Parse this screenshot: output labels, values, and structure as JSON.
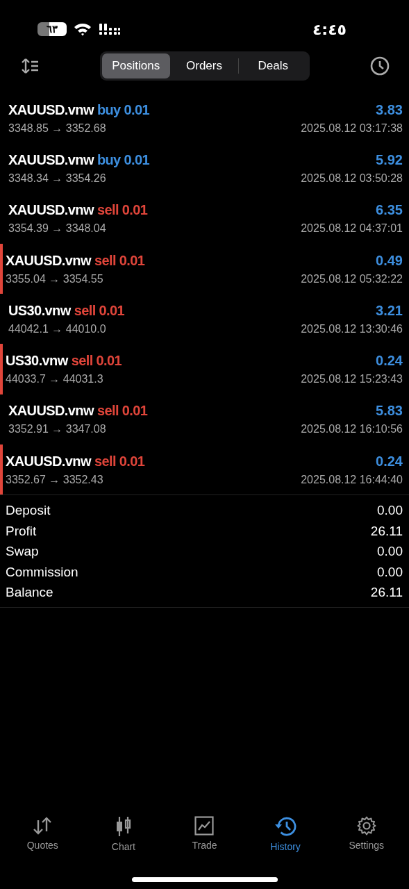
{
  "status_bar": {
    "battery": "٦٣",
    "time": "٤:٤٥"
  },
  "tabs": [
    {
      "label": "Positions",
      "selected": true
    },
    {
      "label": "Orders",
      "selected": false
    },
    {
      "label": "Deals",
      "selected": false
    }
  ],
  "positions": [
    {
      "symbol": "XAUUSD.vnw",
      "kind": "buy",
      "action": "buy 0.01",
      "profit": "3.83",
      "prices": "3348.85 → 3352.68",
      "time": "2025.08.12 03:17:38",
      "marked": false
    },
    {
      "symbol": "XAUUSD.vnw",
      "kind": "buy",
      "action": "buy 0.01",
      "profit": "5.92",
      "prices": "3348.34 → 3354.26",
      "time": "2025.08.12 03:50:28",
      "marked": false
    },
    {
      "symbol": "XAUUSD.vnw",
      "kind": "sell",
      "action": "sell 0.01",
      "profit": "6.35",
      "prices": "3354.39 → 3348.04",
      "time": "2025.08.12 04:37:01",
      "marked": false
    },
    {
      "symbol": "XAUUSD.vnw",
      "kind": "sell",
      "action": "sell 0.01",
      "profit": "0.49",
      "prices": "3355.04 → 3354.55",
      "time": "2025.08.12 05:32:22",
      "marked": true
    },
    {
      "symbol": "US30.vnw",
      "kind": "sell",
      "action": "sell 0.01",
      "profit": "3.21",
      "prices": "44042.1 → 44010.0",
      "time": "2025.08.12 13:30:46",
      "marked": false
    },
    {
      "symbol": "US30.vnw",
      "kind": "sell",
      "action": "sell 0.01",
      "profit": "0.24",
      "prices": "44033.7 → 44031.3",
      "time": "2025.08.12 15:23:43",
      "marked": true
    },
    {
      "symbol": "XAUUSD.vnw",
      "kind": "sell",
      "action": "sell 0.01",
      "profit": "5.83",
      "prices": "3352.91 → 3347.08",
      "time": "2025.08.12 16:10:56",
      "marked": false
    },
    {
      "symbol": "XAUUSD.vnw",
      "kind": "sell",
      "action": "sell 0.01",
      "profit": "0.24",
      "prices": "3352.67 → 3352.43",
      "time": "2025.08.12 16:44:40",
      "marked": true
    }
  ],
  "summary": [
    {
      "label": "Deposit",
      "value": "0.00"
    },
    {
      "label": "Profit",
      "value": "26.11"
    },
    {
      "label": "Swap",
      "value": "0.00"
    },
    {
      "label": "Commission",
      "value": "0.00"
    },
    {
      "label": "Balance",
      "value": "26.11"
    }
  ],
  "tab_bar": [
    {
      "kind": "quotes",
      "label": "Quotes",
      "selected": false
    },
    {
      "kind": "chart",
      "label": "Chart",
      "selected": false
    },
    {
      "kind": "trade",
      "label": "Trade",
      "selected": false
    },
    {
      "kind": "history",
      "label": "History",
      "selected": true
    },
    {
      "kind": "settings",
      "label": "Settings",
      "selected": false
    }
  ]
}
